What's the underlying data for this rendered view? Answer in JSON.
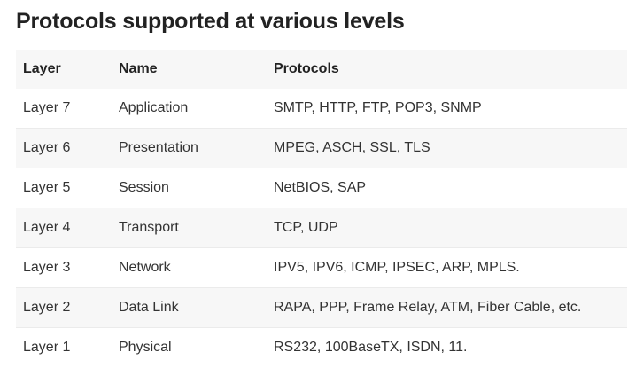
{
  "title": "Protocols supported at various levels",
  "table": {
    "headers": [
      "Layer",
      "Name",
      "Protocols"
    ],
    "rows": [
      [
        "Layer 7",
        "Application",
        "SMTP, HTTP, FTP, POP3, SNMP"
      ],
      [
        "Layer 6",
        "Presentation",
        "MPEG, ASCH, SSL, TLS"
      ],
      [
        "Layer 5",
        "Session",
        "NetBIOS, SAP"
      ],
      [
        "Layer 4",
        "Transport",
        "TCP, UDP"
      ],
      [
        "Layer 3",
        "Network",
        "IPV5, IPV6, ICMP, IPSEC, ARP, MPLS."
      ],
      [
        "Layer 2",
        "Data Link",
        "RAPA, PPP, Frame Relay, ATM, Fiber Cable, etc."
      ],
      [
        "Layer 1",
        "Physical",
        "RS232, 100BaseTX, ISDN, 11."
      ]
    ]
  }
}
